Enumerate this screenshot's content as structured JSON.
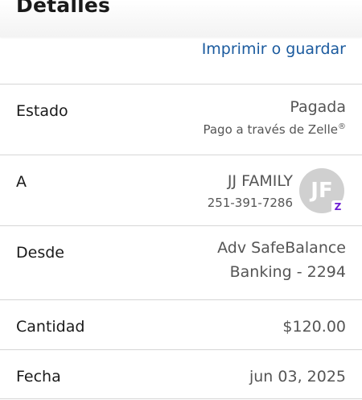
{
  "header": {
    "title": "Detalles"
  },
  "actions": {
    "print_label": "Imprimir o guardar"
  },
  "rows": {
    "estado": {
      "label": "Estado",
      "status": "Pagada",
      "sub": "Pago a través de Zelle",
      "sub_mark": "®"
    },
    "a": {
      "label": "A",
      "name": "JJ FAMILY",
      "phone": "251-391-7286",
      "avatar_initials": "JF",
      "zelle_icon": "Z"
    },
    "desde": {
      "label": "Desde",
      "line1": "Adv SafeBalance",
      "line2": "Banking - 2294"
    },
    "cantidad": {
      "label": "Cantidad",
      "value": "$120.00"
    },
    "fecha": {
      "label": "Fecha",
      "value": "jun 03, 2025"
    }
  },
  "colors": {
    "link": "#1a5a9e",
    "zelle": "#6d1ed4",
    "avatar_bg": "#d0d0d0"
  }
}
